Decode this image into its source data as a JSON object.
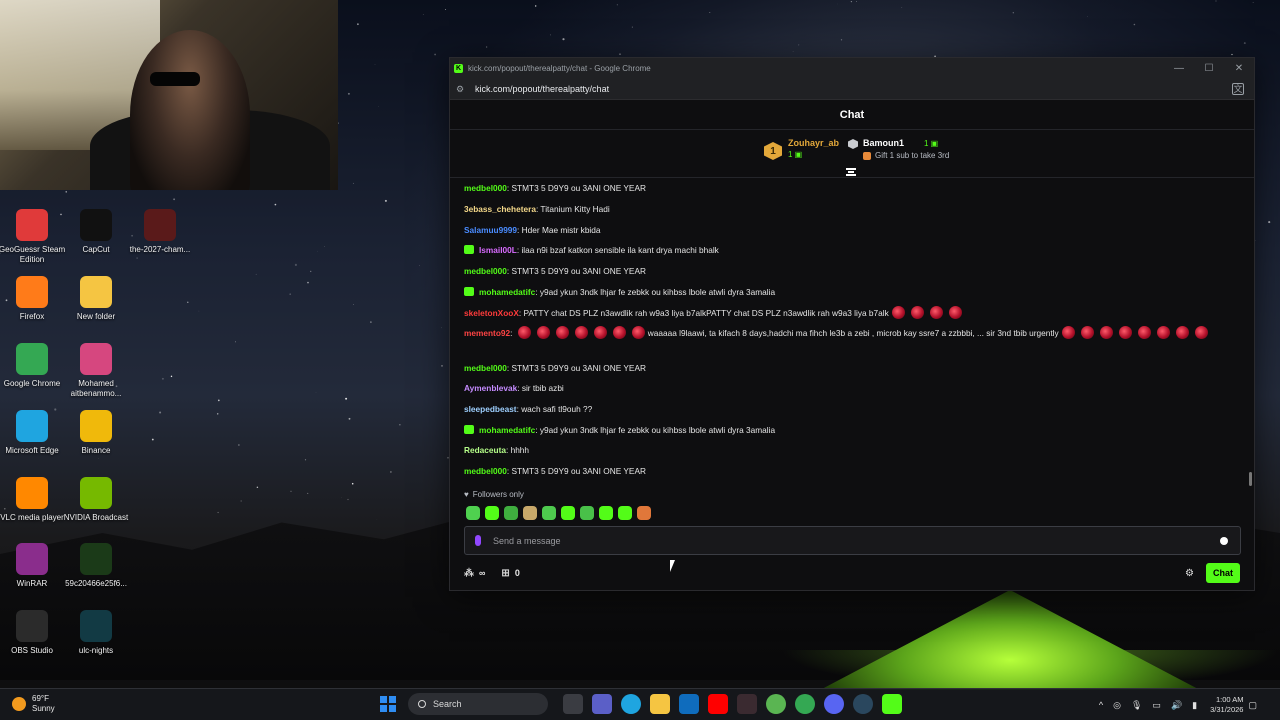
{
  "desktop": {
    "icons": [
      {
        "label": "GeoGuessr Steam Edition",
        "icon": "geoguessr-icon",
        "color": "#e03a3a"
      },
      {
        "label": "CapCut",
        "icon": "capcut-icon",
        "color": "#111111"
      },
      {
        "label": "the-2027-cham...",
        "icon": "image-file-icon",
        "color": "#5a1a1a"
      },
      {
        "label": "Firefox",
        "icon": "firefox-icon",
        "color": "#ff7b19"
      },
      {
        "label": "New folder",
        "icon": "folder-icon",
        "color": "#f5c542"
      },
      {
        "label": "Google Chrome",
        "icon": "chrome-icon",
        "color": "#34a853"
      },
      {
        "label": "Mohamed aitbenammo...",
        "icon": "folder-image-icon",
        "color": "#d6477f"
      },
      {
        "label": "Microsoft Edge",
        "icon": "edge-icon",
        "color": "#1fa5e0"
      },
      {
        "label": "Binance",
        "icon": "binance-icon",
        "color": "#f0b90b"
      },
      {
        "label": "VLC media player",
        "icon": "vlc-icon",
        "color": "#ff8800"
      },
      {
        "label": "NVIDIA Broadcast",
        "icon": "nvidia-icon",
        "color": "#76b900"
      },
      {
        "label": "WinRAR",
        "icon": "winrar-icon",
        "color": "#8a2d8c"
      },
      {
        "label": "59c20466e25f6...",
        "icon": "image-file-icon",
        "color": "#1b3a18"
      },
      {
        "label": "OBS Studio",
        "icon": "obs-icon",
        "color": "#2b2b2b"
      },
      {
        "label": "ulc-nights",
        "icon": "image-file-icon",
        "color": "#123a44"
      }
    ]
  },
  "browser": {
    "title": "kick.com/popout/therealpatty/chat - Google Chrome",
    "url": "kick.com/popout/therealpatty/chat",
    "window_controls": [
      "—",
      "☐",
      "✕"
    ]
  },
  "chat": {
    "header": "Chat",
    "leaderboard": {
      "first": {
        "rank": "1",
        "name": "Zouhayr_ab",
        "count": "1"
      },
      "second": {
        "name": "Bamoun1",
        "count": "1",
        "note": "Gift 1 sub to take 3rd"
      }
    },
    "messages": [
      {
        "user": "medbel000",
        "color": "#53fc18",
        "text": ": STMT3 5 D9Y9 ou 3ANI ONE YEAR"
      },
      {
        "user": "3ebass_chehetera",
        "color": "#f5d98a",
        "text": ": Titanium Kitty Hadi"
      },
      {
        "user": "Salamuu9999",
        "color": "#4a8cff",
        "text": ": Hder Mae mistr kbida"
      },
      {
        "user": "Ismail00L",
        "color": "#d86bff",
        "text": ": ilaa n9i bzaf katkon sensible ila kant drya machi bhalk",
        "badge": "#53fc18"
      },
      {
        "user": "medbel000",
        "color": "#53fc18",
        "text": ": STMT3 5 D9Y9 ou 3ANI ONE YEAR"
      },
      {
        "user": "mohamedatifc",
        "color": "#53fc18",
        "text": ": y9ad ykun 3ndk lhjar fe zebkk ou kihbss lbole atwli dyra 3amalia",
        "badge": "#53fc18"
      },
      {
        "user": "skeletonXooX",
        "color": "#ff3b3b",
        "text": ": PATTY chat DS PLZ n3awdlik rah w9a3 liya b7alkPATTY chat DS PLZ n3awdlik rah w9a3 liya b7alk"
      },
      {
        "user": "memento92",
        "color": "#ff4444",
        "text": "waaaaa l9laawi, ta kifach 8 days,hadchi ma fihch le3b a zebi , microb kay ssre7 a zzbbbi, ... sir 3nd tbib urgently"
      },
      {
        "user": "medbel000",
        "color": "#53fc18",
        "text": ": STMT3 5 D9Y9 ou 3ANI ONE YEAR"
      },
      {
        "user": "Aymenblevak",
        "color": "#c58bff",
        "text": ": sir tbib azbi"
      },
      {
        "user": "sleepedbeast",
        "color": "#9ed0ff",
        "text": ": wach safi tl9ouh ??"
      },
      {
        "user": "mohamedatifc",
        "color": "#53fc18",
        "text": ": y9ad ykun 3ndk lhjar fe zebkk ou kihbss lbole atwli dyra 3amalia",
        "badge": "#53fc18"
      },
      {
        "user": "Redaceuta",
        "color": "#b6ff8a",
        "text": ": hhhh"
      },
      {
        "user": "medbel000",
        "color": "#53fc18",
        "text": ": STMT3 5 D9Y9 ou 3ANI ONE YEAR"
      }
    ],
    "followers_only": "Followers only",
    "input_placeholder": "Send a message",
    "infinite_symbol": "∞",
    "store_count": "0",
    "send_label": "Chat",
    "accent": "#53fc18"
  },
  "taskbar": {
    "weather_temp": "69°F",
    "weather_desc": "Sunny",
    "search_placeholder": "Search",
    "time": "1:00 AM",
    "date": "3/31/2026"
  }
}
